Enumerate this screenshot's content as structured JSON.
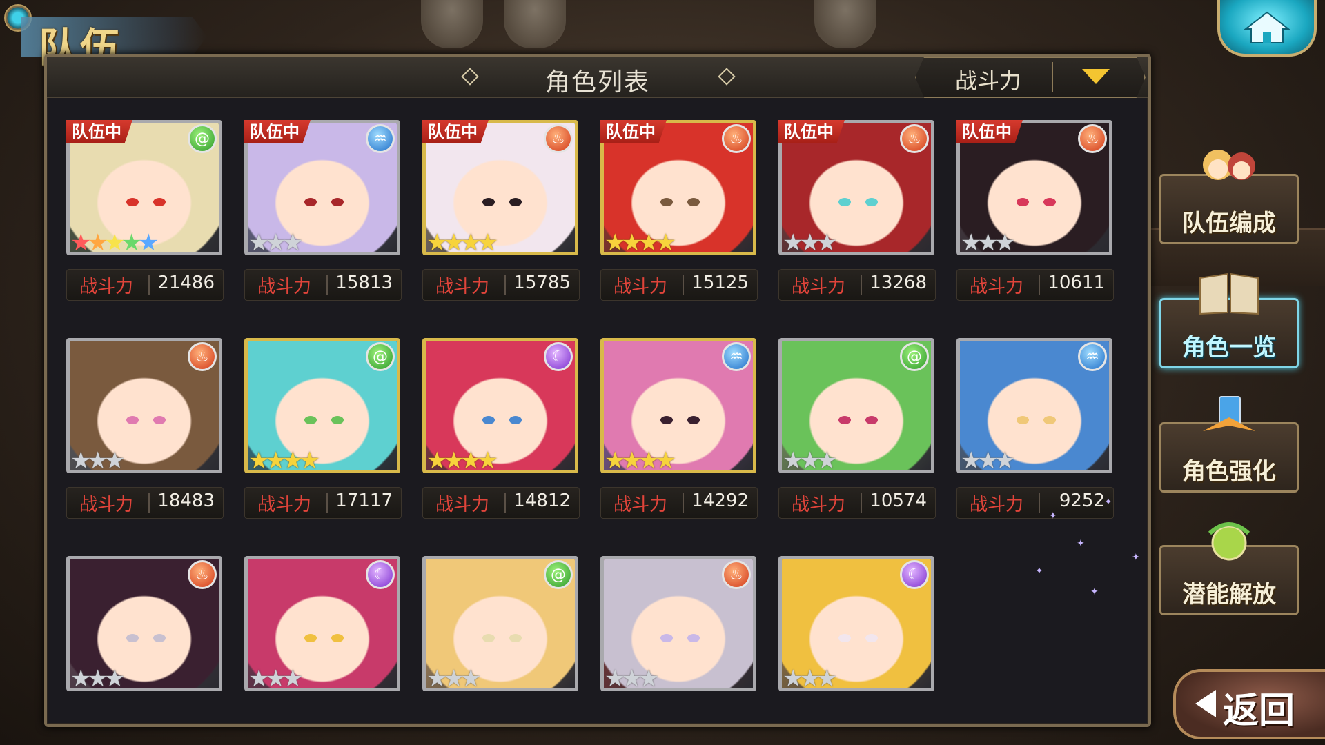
{
  "header": {
    "title": "队伍",
    "panel_title": "角色列表"
  },
  "sort": {
    "label": "战斗力"
  },
  "power_label": "战斗力",
  "team_badge": "队伍中",
  "colors": {
    "accent_gold": "#f4c531",
    "badge_red": "#d63a2e",
    "active_cyan": "#7fd6e8"
  },
  "characters": [
    {
      "in_team": true,
      "element": "wind",
      "rarity": 5,
      "frame": "silver",
      "power": "21486"
    },
    {
      "in_team": true,
      "element": "water",
      "rarity": 3,
      "frame": "silver",
      "power": "15813"
    },
    {
      "in_team": true,
      "element": "fire",
      "rarity": 4,
      "frame": "gold",
      "power": "15785"
    },
    {
      "in_team": true,
      "element": "fire",
      "rarity": 4,
      "frame": "gold",
      "power": "15125"
    },
    {
      "in_team": true,
      "element": "fire",
      "rarity": 3,
      "frame": "silver",
      "power": "13268"
    },
    {
      "in_team": true,
      "element": "fire",
      "rarity": 3,
      "frame": "silver",
      "power": "10611"
    },
    {
      "in_team": false,
      "element": "fire",
      "rarity": 3,
      "frame": "silver",
      "power": "18483"
    },
    {
      "in_team": false,
      "element": "wind",
      "rarity": 4,
      "frame": "gold",
      "power": "17117"
    },
    {
      "in_team": false,
      "element": "dark",
      "rarity": 4,
      "frame": "gold",
      "power": "14812"
    },
    {
      "in_team": false,
      "element": "water",
      "rarity": 4,
      "frame": "gold",
      "power": "14292"
    },
    {
      "in_team": false,
      "element": "wind",
      "rarity": 3,
      "frame": "silver",
      "power": "10574"
    },
    {
      "in_team": false,
      "element": "water",
      "rarity": 3,
      "frame": "silver",
      "power": "9252"
    },
    {
      "in_team": false,
      "element": "fire",
      "rarity": 3,
      "frame": "silver",
      "power": ""
    },
    {
      "in_team": false,
      "element": "dark",
      "rarity": 3,
      "frame": "silver",
      "power": ""
    },
    {
      "in_team": false,
      "element": "wind",
      "rarity": 3,
      "frame": "silver",
      "power": ""
    },
    {
      "in_team": false,
      "element": "fire",
      "rarity": 3,
      "frame": "silver",
      "power": ""
    },
    {
      "in_team": false,
      "element": "dark",
      "rarity": 3,
      "frame": "silver",
      "power": ""
    }
  ],
  "side_menu": {
    "team_edit": "队伍编成",
    "character_list": "角色一览",
    "character_enhance": "角色强化",
    "potential_unlock": "潜能解放"
  },
  "back_label": "返回",
  "icons": {
    "home": "home-icon",
    "sort_toggle": "triangle-down-icon",
    "back": "arrow-left-icon"
  }
}
